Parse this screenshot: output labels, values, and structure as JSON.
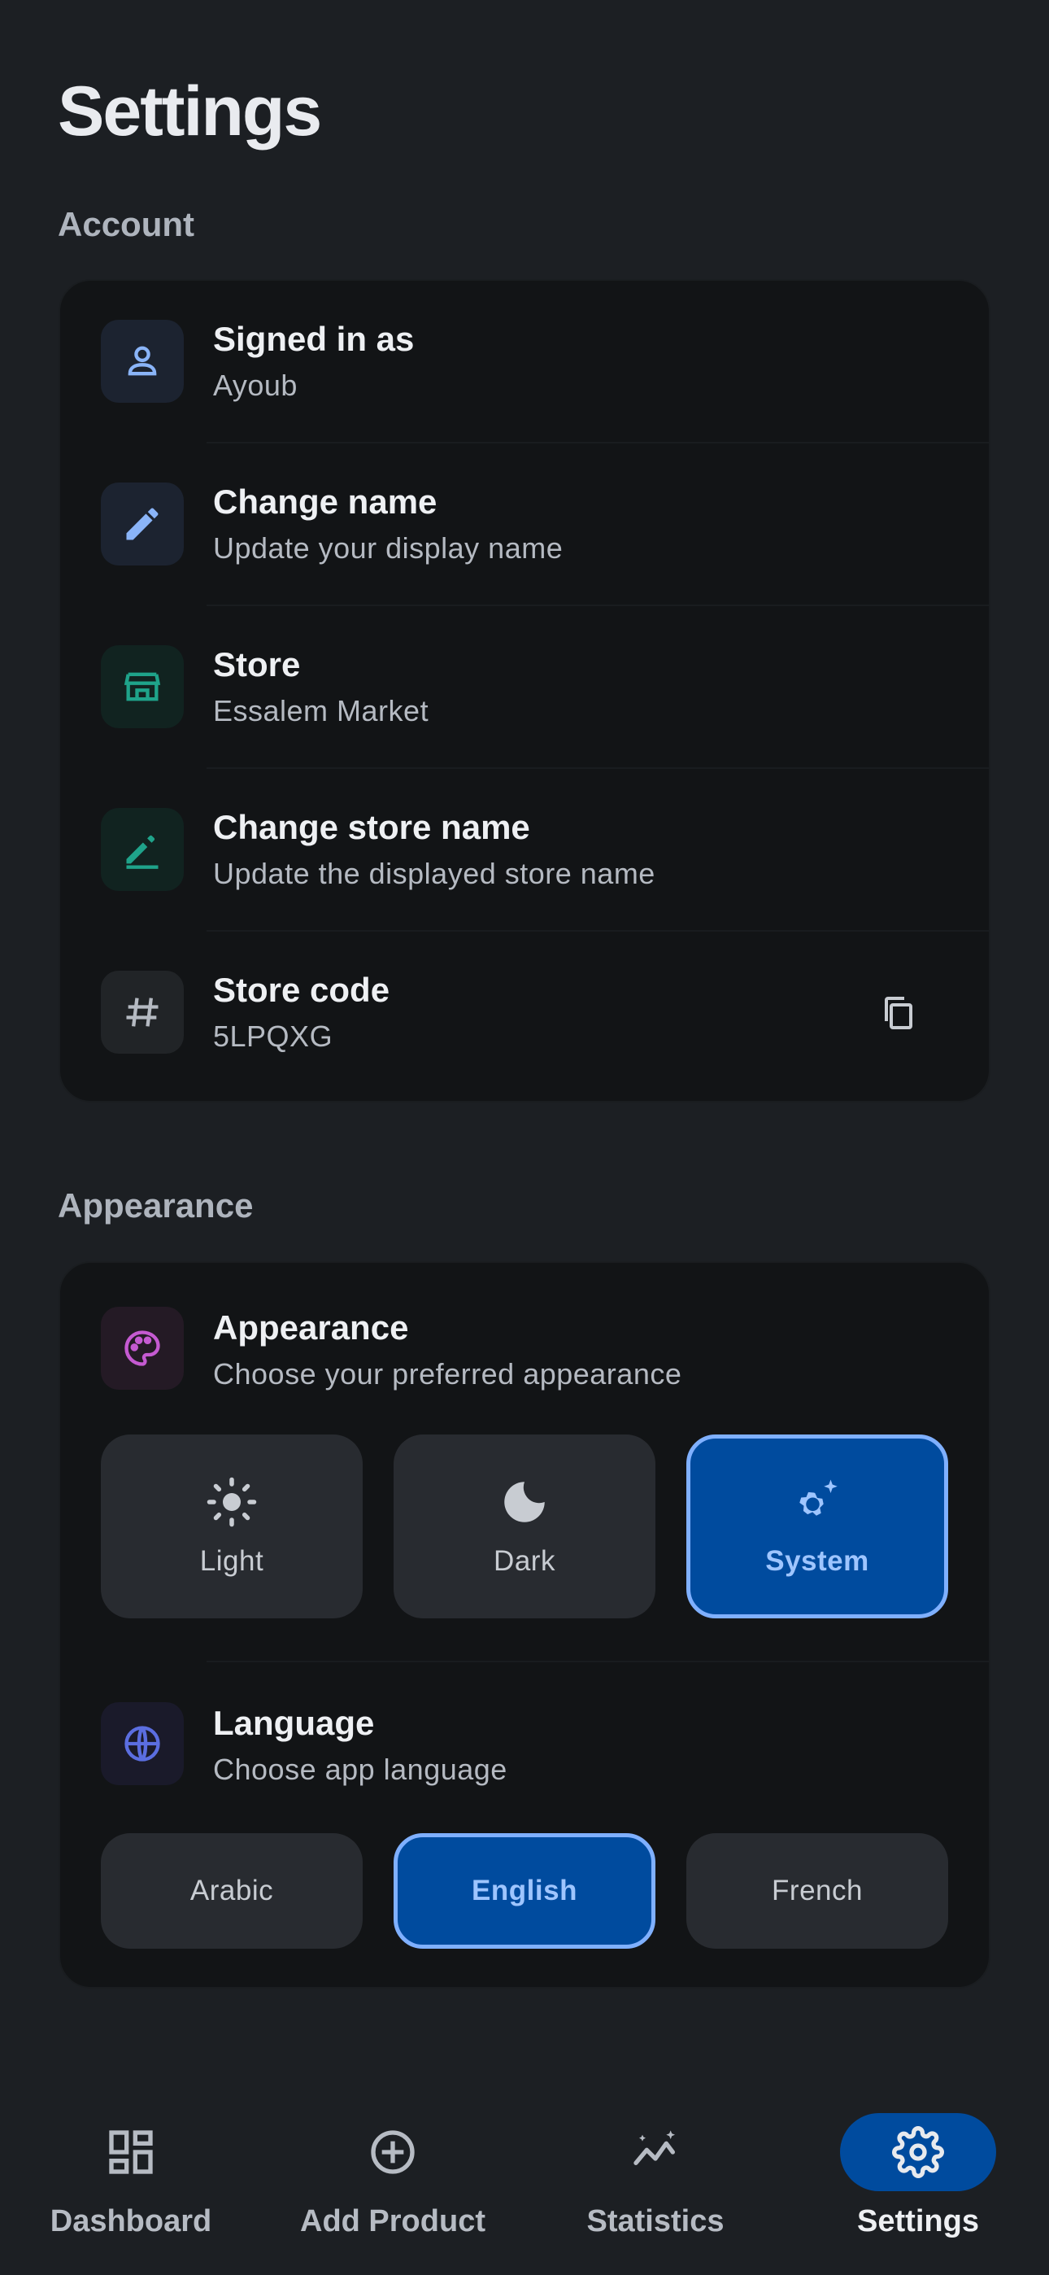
{
  "page": {
    "title": "Settings"
  },
  "account": {
    "section_title": "Account",
    "rows": [
      {
        "title": "Signed in as",
        "subtitle": "Ayoub",
        "icon": "person-icon"
      },
      {
        "title": "Change name",
        "subtitle": "Update your display name",
        "icon": "pencil-icon"
      },
      {
        "title": "Store",
        "subtitle": "Essalem Market",
        "icon": "storefront-icon"
      },
      {
        "title": "Change store name",
        "subtitle": "Update the displayed store name",
        "icon": "edit-pen-icon"
      },
      {
        "title": "Store code",
        "subtitle": "5LPQXG",
        "icon": "hash-icon",
        "action_icon": "copy-icon"
      }
    ]
  },
  "appearance": {
    "section_title": "Appearance",
    "theme": {
      "title": "Appearance",
      "subtitle": "Choose your preferred appearance",
      "icon": "palette-icon",
      "options": [
        {
          "label": "Light",
          "icon": "sun-icon",
          "selected": false
        },
        {
          "label": "Dark",
          "icon": "moon-icon",
          "selected": false
        },
        {
          "label": "System",
          "icon": "settings-sparkle-icon",
          "selected": true
        }
      ]
    },
    "language": {
      "title": "Language",
      "subtitle": "Choose app language",
      "icon": "globe-icon",
      "options": [
        {
          "label": "Arabic",
          "selected": false
        },
        {
          "label": "English",
          "selected": true
        },
        {
          "label": "French",
          "selected": false
        }
      ]
    }
  },
  "bottom_nav": {
    "items": [
      {
        "label": "Dashboard",
        "icon": "dashboard-icon",
        "active": false
      },
      {
        "label": "Add Product",
        "icon": "add-circle-icon",
        "active": false
      },
      {
        "label": "Statistics",
        "icon": "trending-sparkle-icon",
        "active": false
      },
      {
        "label": "Settings",
        "icon": "gear-icon",
        "active": true
      }
    ]
  },
  "colors": {
    "background": "#1c1f23",
    "card": "#121416",
    "accent": "#004b9e",
    "accent_border": "#7fb0ff",
    "selected_text": "#9ec5ff"
  }
}
